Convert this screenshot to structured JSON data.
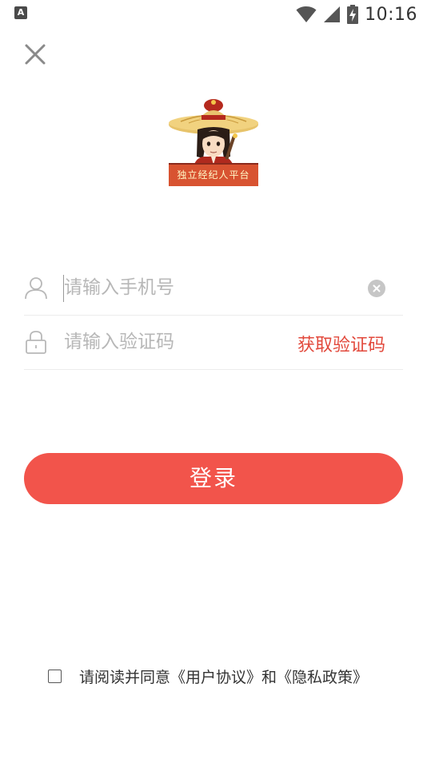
{
  "status_bar": {
    "app_badge": "A",
    "time": "10:16"
  },
  "logo": {
    "banner_text": "独立经纪人平台"
  },
  "form": {
    "phone_placeholder": "请输入手机号",
    "phone_value": "",
    "code_placeholder": "请输入验证码",
    "code_value": "",
    "get_code_label": "获取验证码"
  },
  "login_label": "登录",
  "agreement": {
    "prefix": "请阅读并同意",
    "user_agreement": "《用户协议》",
    "connector": "和",
    "privacy_policy": "《隐私政策》",
    "checked": false
  },
  "colors": {
    "accent": "#f2544b",
    "link_red": "#e2493c",
    "placeholder": "#b7b7b7"
  }
}
